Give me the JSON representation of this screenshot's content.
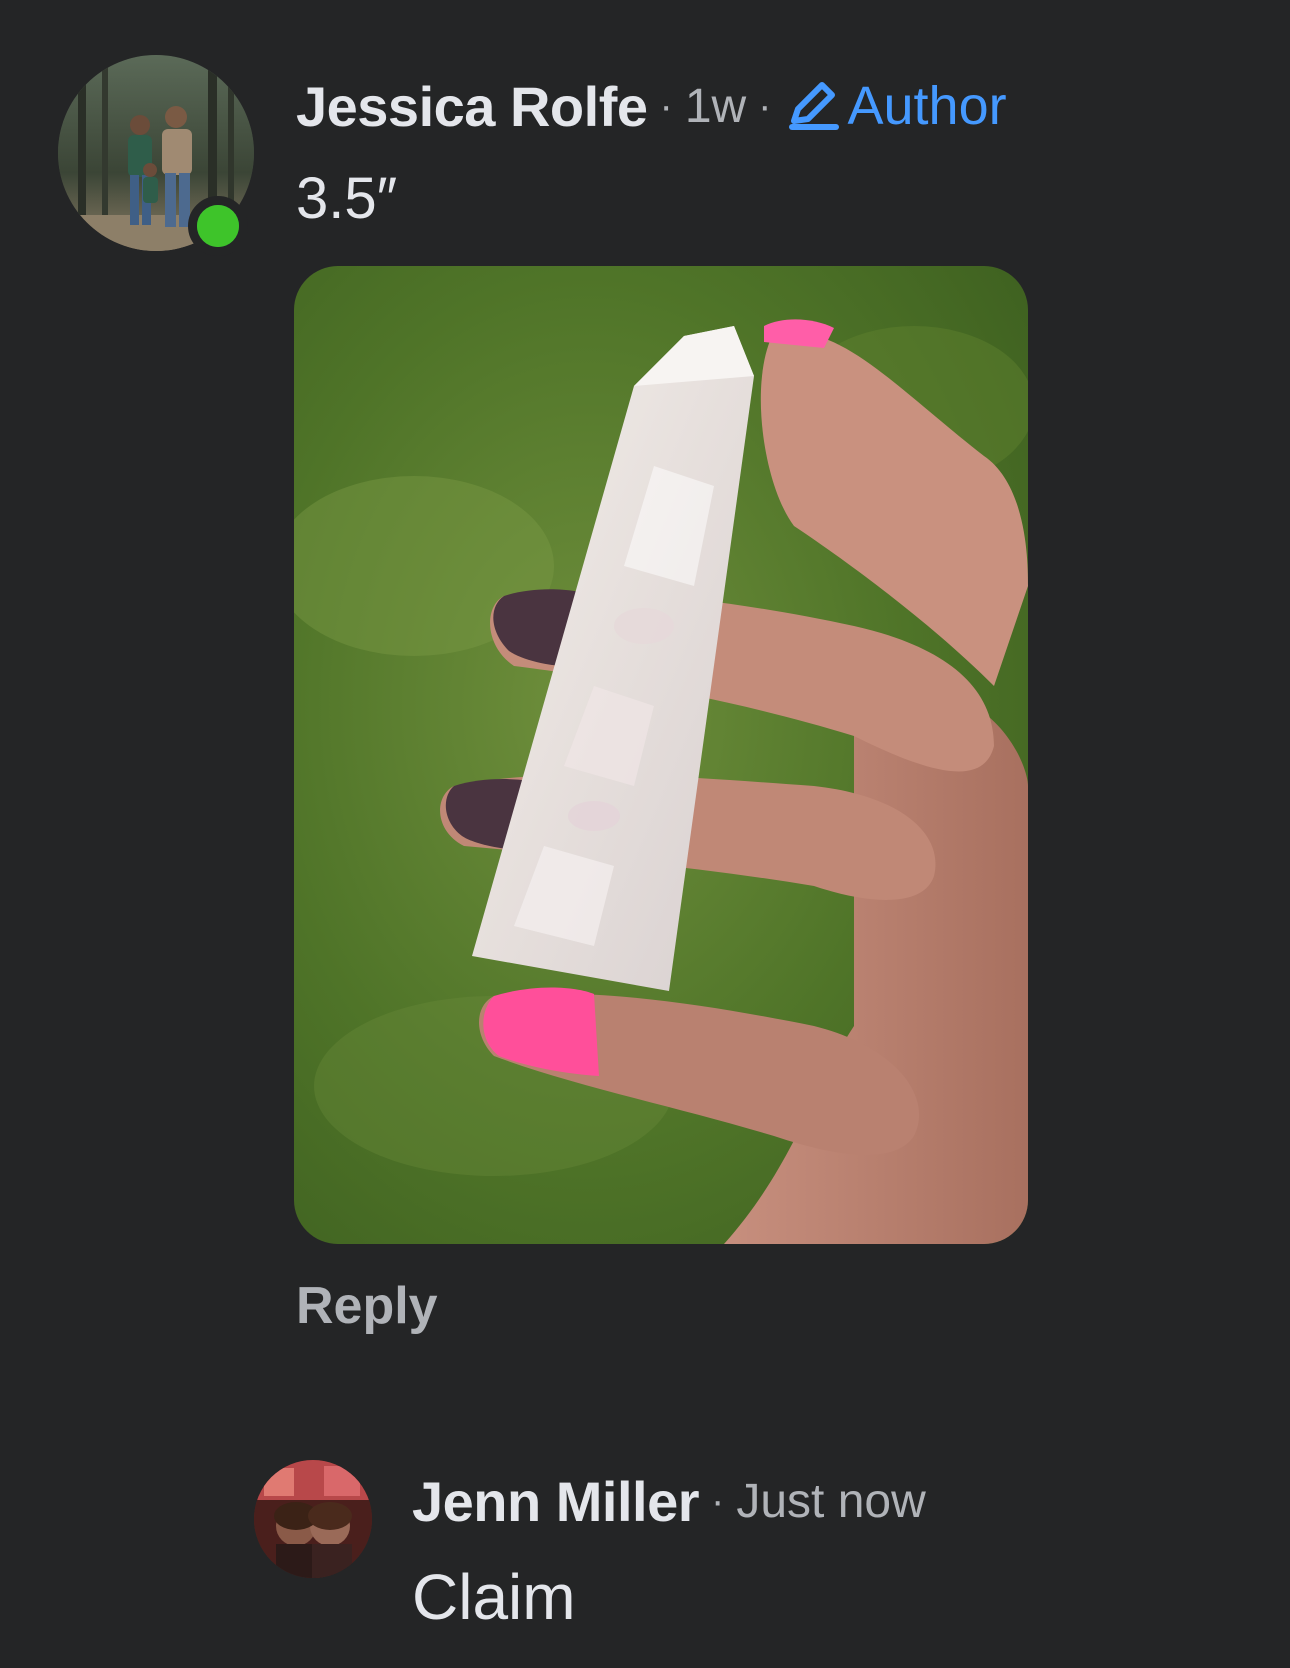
{
  "comment": {
    "author": "Jessica Rolfe",
    "separator": "·",
    "time": "1w",
    "badge_label": "Author",
    "text": "3.5″",
    "reply_label": "Reply",
    "online": true,
    "photo_subject": "hand holding white crystal tower over grass"
  },
  "reply": {
    "author": "Jenn Miller",
    "separator": "·",
    "time": "Just now",
    "text": "Claim"
  },
  "colors": {
    "background": "#242526",
    "primary_text": "#e4e6eb",
    "secondary_text": "#b0b3b8",
    "accent": "#4599ff",
    "online": "#3ec42a"
  },
  "icons": {
    "badge": "pencil-icon"
  }
}
